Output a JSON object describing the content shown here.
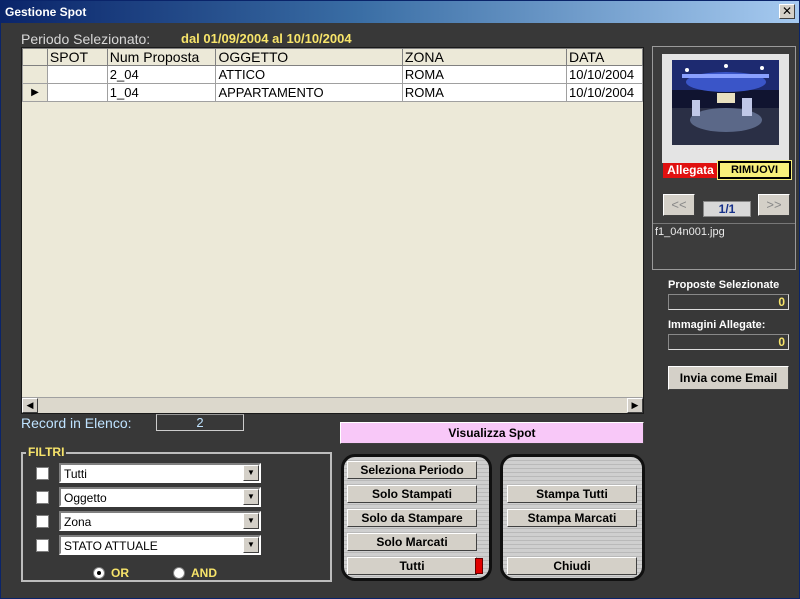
{
  "window": {
    "title": "Gestione Spot",
    "close_glyph": "✕"
  },
  "period": {
    "label": "Periodo Selezionato:",
    "value": "dal 01/09/2004 al 10/10/2004"
  },
  "grid": {
    "columns": [
      "SPOT",
      "Num Proposta",
      "OGGETTO",
      "ZONA",
      "DATA"
    ],
    "rows": [
      {
        "selector": "",
        "spot": "",
        "num": "2_04",
        "oggetto": "ATTICO",
        "zona": "ROMA",
        "data": "10/10/2004"
      },
      {
        "selector": "▶",
        "spot": "",
        "num": "1_04",
        "oggetto": "APPARTAMENTO",
        "zona": "ROMA",
        "data": "10/10/2004"
      }
    ],
    "scroll_left": "◀",
    "scroll_right": "▶"
  },
  "record": {
    "label": "Record in Elenco:",
    "count": "2"
  },
  "visualizza": "Visualizza Spot",
  "filters": {
    "legend": "FILTRI",
    "combos": [
      "Tutti",
      "Oggetto",
      "Zona",
      "STATO ATTUALE"
    ],
    "or_label": "OR",
    "and_label": "AND",
    "selected": "OR",
    "dropdown_glyph": "▼"
  },
  "left_panel": [
    "Seleziona Periodo",
    "Solo Stampati",
    "Solo da Stampare",
    "Solo Marcati",
    "Tutti"
  ],
  "right_panel": {
    "stampa_tutti": "Stampa Tutti",
    "stampa_marcati": "Stampa Marcati",
    "chiudi": "Chiudi"
  },
  "image": {
    "allegata": "Allegata",
    "rimuovi": "RIMUOVI",
    "prev": "<<",
    "next": ">>",
    "page": "1/1",
    "filename": "f1_04n001.jpg"
  },
  "stats": {
    "proposte_label": "Proposte Selezionate",
    "proposte_value": "0",
    "immagini_label": "Immagini Allegate:",
    "immagini_value": "0"
  },
  "email_button": "Invia come Email",
  "colors": {
    "accent_yellow": "#f7e46a",
    "title_blue": "#0a246a",
    "pink_button": "#f8c8f8",
    "red_badge": "#e01010"
  }
}
